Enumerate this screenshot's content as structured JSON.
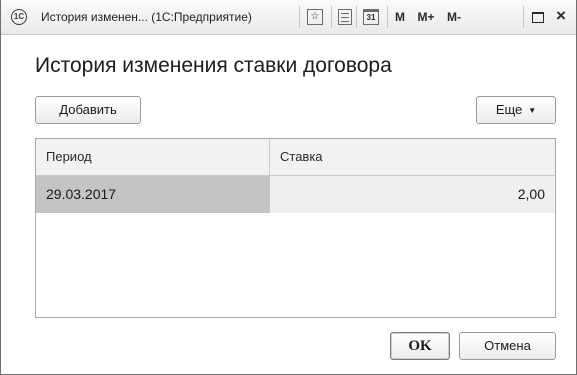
{
  "window": {
    "title": "История изменен... (1С:Предприятие)",
    "app_icon": "1c-logo-icon",
    "icons": [
      "1c-logo-icon",
      "favorite-star-icon",
      "calculator-icon",
      "calendar-icon",
      "maximize-icon",
      "close-icon"
    ],
    "calendar_label": "31",
    "memory_buttons": {
      "m": "M",
      "m_plus": "M+",
      "m_minus": "M-"
    },
    "close_glyph": "×"
  },
  "page": {
    "title": "История изменения ставки договора"
  },
  "toolbar": {
    "add_label": "Добавить",
    "more_label": "Еще",
    "more_caret": "▼"
  },
  "table": {
    "columns": [
      "Период",
      "Ставка"
    ],
    "rows": [
      {
        "period": "29.03.2017",
        "rate": "2,00"
      }
    ]
  },
  "footer": {
    "ok_label": "OK",
    "cancel_label": "Отмена"
  },
  "colors": {
    "selected_row": "#c4c4c4",
    "row_background": "#efefef",
    "header_background": "#f2f2f2"
  }
}
